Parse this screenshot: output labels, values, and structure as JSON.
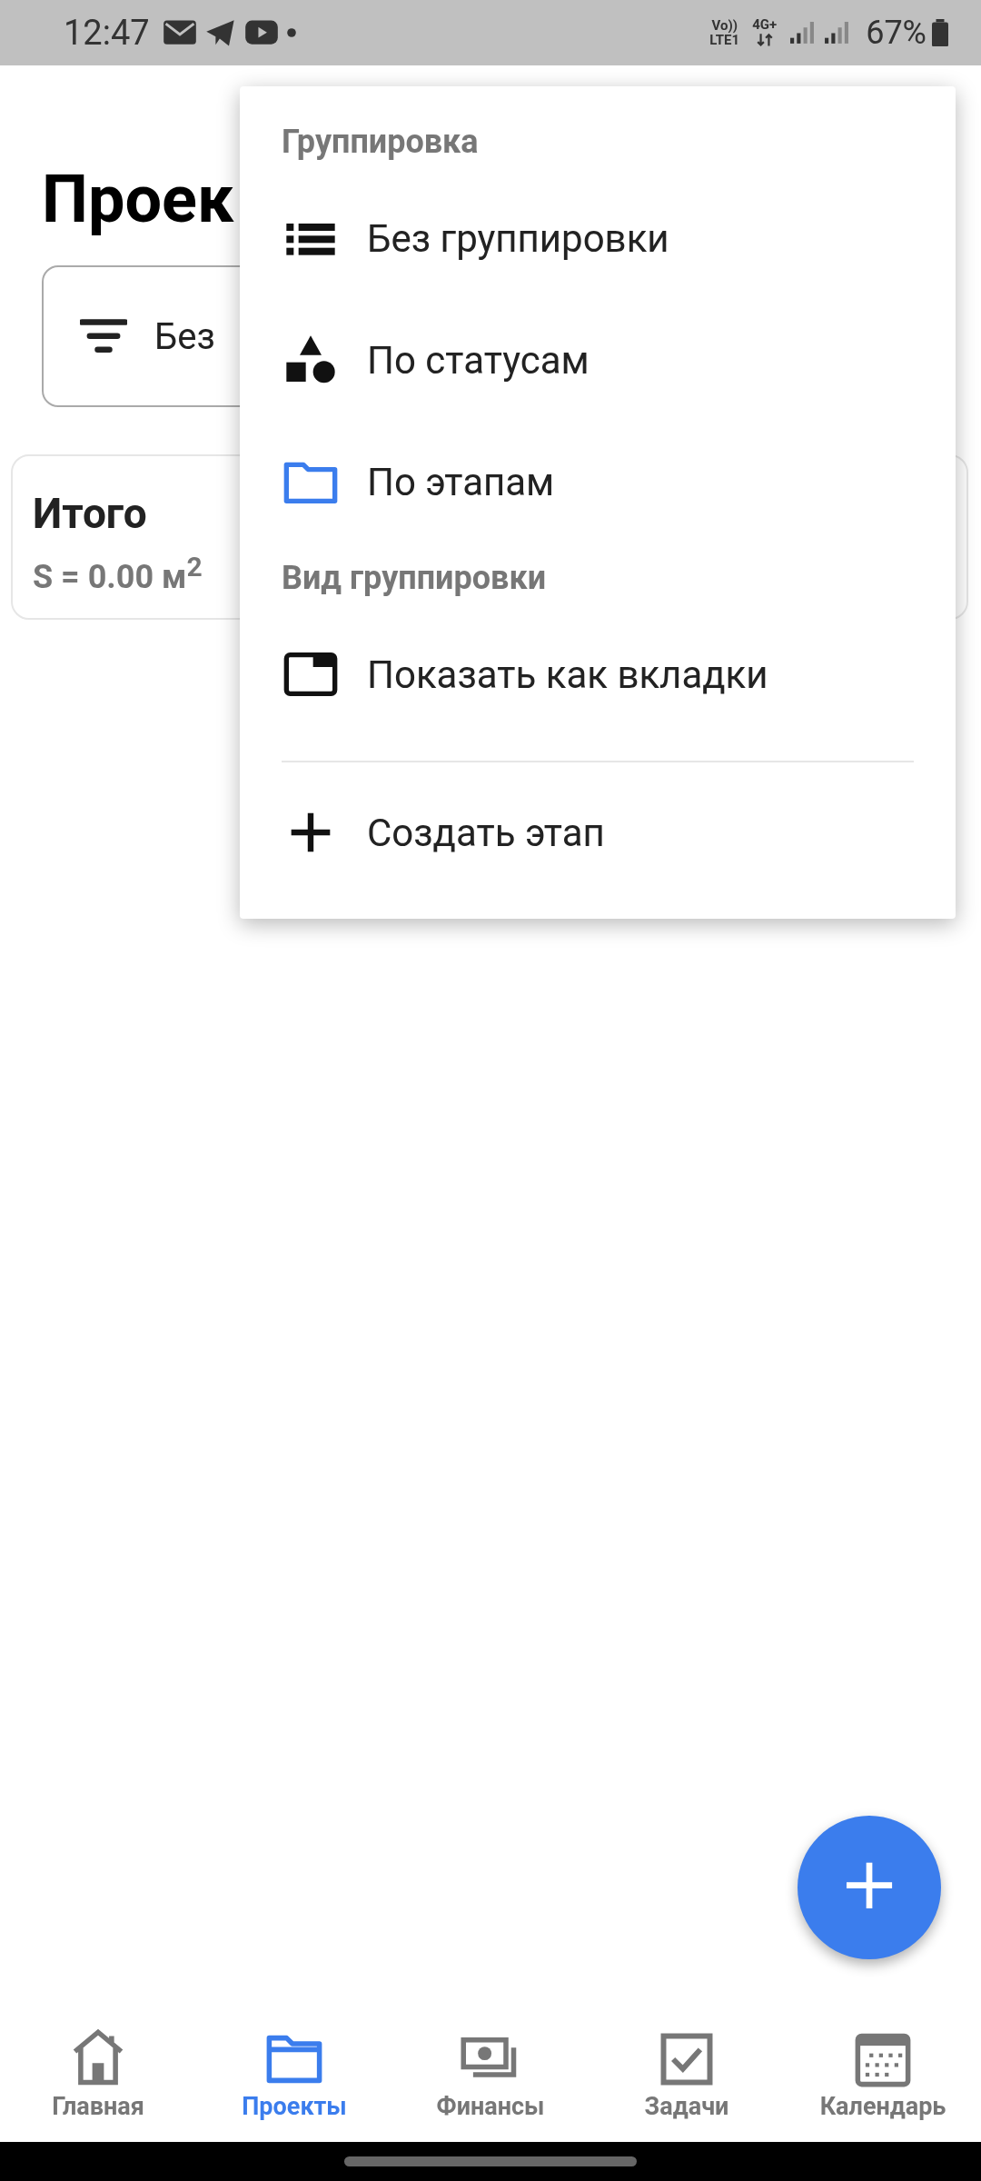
{
  "status_bar": {
    "time": "12:47",
    "network_top": "Vo))",
    "network_bottom": "LTE1",
    "data_top": "4G+",
    "battery": "67%"
  },
  "page": {
    "title": "Проек",
    "filter_button": {
      "label": "Без"
    },
    "summary_card": {
      "title": "Итого",
      "area": "S = 0.00 м$^{2}$"
    }
  },
  "menu": {
    "sections": [
      {
        "title": "Группировка",
        "items": [
          {
            "label": "Без группировки"
          },
          {
            "label": "По статусам"
          },
          {
            "label": "По этапам"
          }
        ]
      },
      {
        "title": "Вид группировки",
        "items": [
          {
            "label": "Показать как вкладки"
          }
        ]
      }
    ],
    "actions": [
      {
        "label": "Создать этап"
      }
    ]
  },
  "fab": {
    "label": "+"
  },
  "bottom_nav": [
    {
      "label": "Главная",
      "selected": false
    },
    {
      "label": "Проекты",
      "selected": true
    },
    {
      "label": "Финансы",
      "selected": false
    },
    {
      "label": "Задачи",
      "selected": false
    },
    {
      "label": "Календарь",
      "selected": false
    }
  ]
}
